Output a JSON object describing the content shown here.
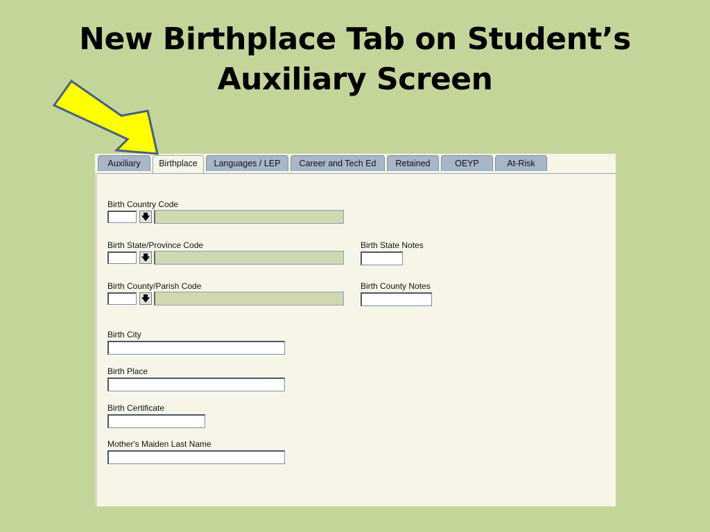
{
  "slide": {
    "title_line1": "New Birthplace Tab on Student’s",
    "title_line2": "Auxiliary Screen"
  },
  "colors": {
    "slide_background": "#c4d59a",
    "arrow_fill": "#ffff00",
    "tab_inactive": "#a7b6c9",
    "panel_background": "#f6f5e8",
    "description_field": "#cfd8b1"
  },
  "tabs": [
    {
      "label": "Auxiliary",
      "active": false
    },
    {
      "label": "Birthplace",
      "active": true
    },
    {
      "label": "Languages / LEP",
      "active": false
    },
    {
      "label": "Career and Tech Ed",
      "active": false
    },
    {
      "label": "Retained",
      "active": false
    },
    {
      "label": "OEYP",
      "active": false
    },
    {
      "label": "At-Risk",
      "active": false
    }
  ],
  "form": {
    "birth_country_code": {
      "label": "Birth Country Code",
      "value": "",
      "description": ""
    },
    "birth_state_code": {
      "label": "Birth State/Province Code",
      "value": "",
      "description": ""
    },
    "birth_state_notes": {
      "label": "Birth State Notes",
      "value": ""
    },
    "birth_county_code": {
      "label": "Birth County/Parish Code",
      "value": "",
      "description": ""
    },
    "birth_county_notes": {
      "label": "Birth County Notes",
      "value": ""
    },
    "birth_city": {
      "label": "Birth City",
      "value": ""
    },
    "birth_place": {
      "label": "Birth Place",
      "value": ""
    },
    "birth_certificate": {
      "label": "Birth Certificate",
      "value": ""
    },
    "mothers_maiden_last_name": {
      "label": "Mother's Maiden Last Name",
      "value": ""
    }
  },
  "icons": {
    "lookup_button": "down-arrow-icon",
    "pointer": "yellow-arrow-icon"
  }
}
